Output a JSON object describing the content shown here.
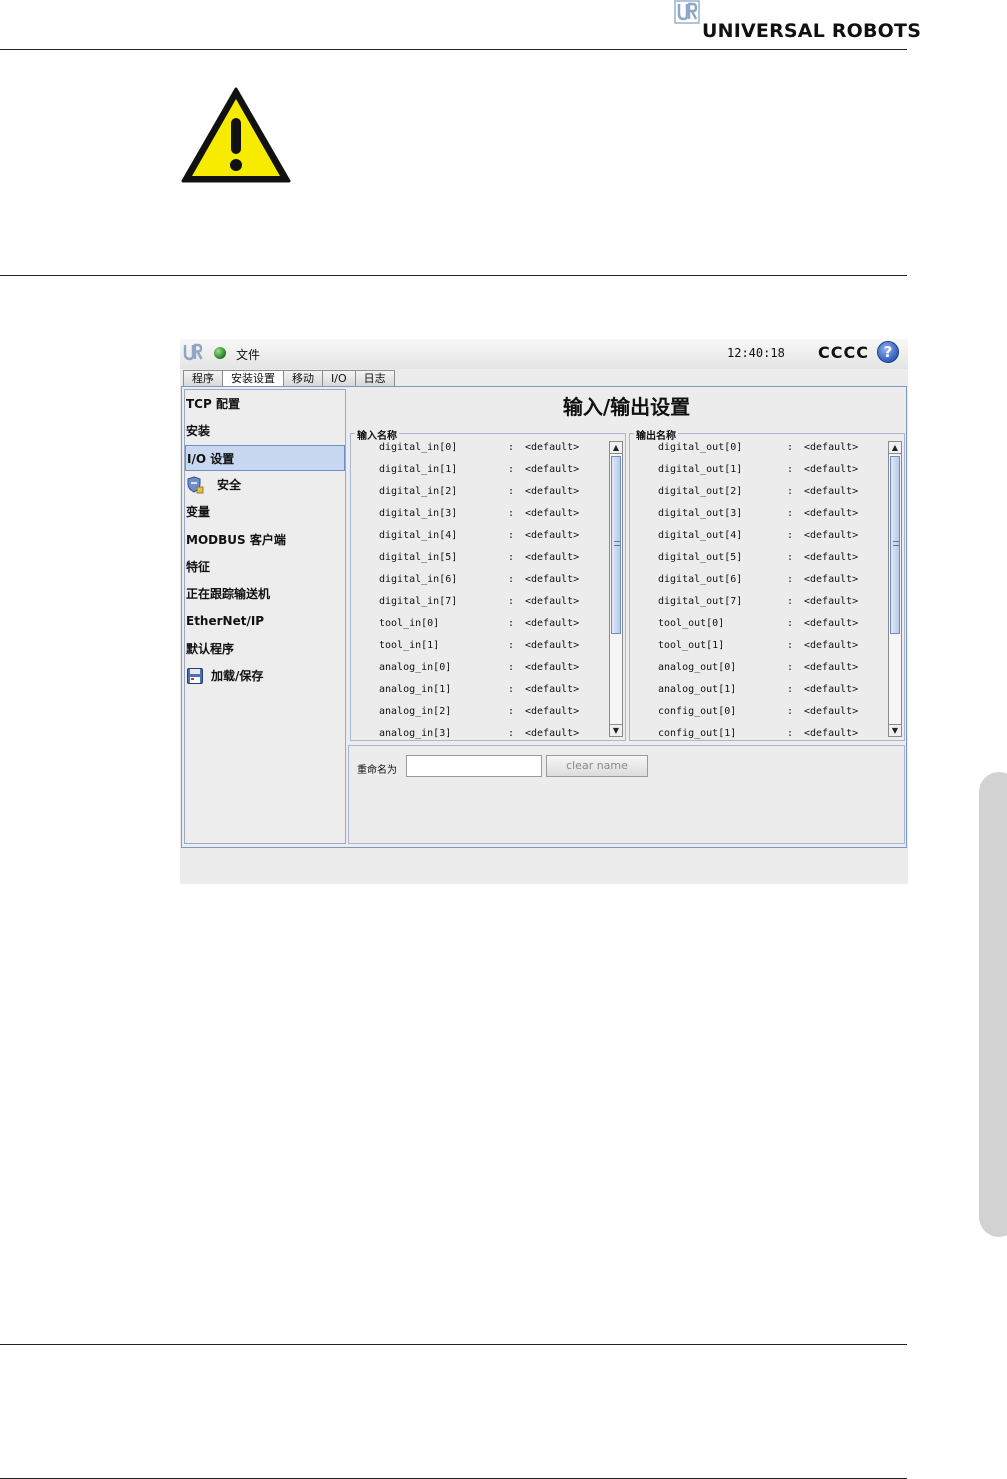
{
  "header": {
    "brand_text": "UNIVERSAL ROBOTS",
    "logo_letters": "UR"
  },
  "warning": {
    "icon": "warning-triangle-icon"
  },
  "app": {
    "titlebar": {
      "file_menu": "文件",
      "clock": "12:40:18",
      "robot_name": "CCCC",
      "help_symbol": "?"
    },
    "tabs": [
      {
        "label": "程序",
        "active": false
      },
      {
        "label": "安装设置",
        "active": true
      },
      {
        "label": "移动",
        "active": false
      },
      {
        "label": "I/O",
        "active": false
      },
      {
        "label": "日志",
        "active": false
      }
    ],
    "menu": {
      "items": [
        {
          "label": "TCP 配置"
        },
        {
          "label": "安装"
        },
        {
          "label": "I/O 设置",
          "selected": true
        },
        {
          "label": "安全",
          "icon": "shield-lock-icon"
        },
        {
          "label": "变量"
        },
        {
          "label": "MODBUS 客户端"
        },
        {
          "label": "特征"
        },
        {
          "label": "正在跟踪输送机"
        },
        {
          "label": "EtherNet/IP"
        },
        {
          "label": "默认程序"
        },
        {
          "label": "加载/保存",
          "icon": "floppy-disk-icon"
        }
      ]
    },
    "content": {
      "title": "输入/输出设置",
      "inputs": {
        "title": "输入名称",
        "rows": [
          {
            "name": "digital_in[0]",
            "sep": ":",
            "value": "<default>"
          },
          {
            "name": "digital_in[1]",
            "sep": ":",
            "value": "<default>"
          },
          {
            "name": "digital_in[2]",
            "sep": ":",
            "value": "<default>"
          },
          {
            "name": "digital_in[3]",
            "sep": ":",
            "value": "<default>"
          },
          {
            "name": "digital_in[4]",
            "sep": ":",
            "value": "<default>"
          },
          {
            "name": "digital_in[5]",
            "sep": ":",
            "value": "<default>"
          },
          {
            "name": "digital_in[6]",
            "sep": ":",
            "value": "<default>"
          },
          {
            "name": "digital_in[7]",
            "sep": ":",
            "value": "<default>"
          },
          {
            "name": "tool_in[0]",
            "sep": ":",
            "value": "<default>"
          },
          {
            "name": "tool_in[1]",
            "sep": ":",
            "value": "<default>"
          },
          {
            "name": "analog_in[0]",
            "sep": ":",
            "value": "<default>"
          },
          {
            "name": "analog_in[1]",
            "sep": ":",
            "value": "<default>"
          },
          {
            "name": "analog_in[2]",
            "sep": ":",
            "value": "<default>"
          },
          {
            "name": "analog_in[3]",
            "sep": ":",
            "value": "<default>"
          }
        ]
      },
      "outputs": {
        "title": "输出名称",
        "rows": [
          {
            "name": "digital_out[0]",
            "sep": ":",
            "value": "<default>"
          },
          {
            "name": "digital_out[1]",
            "sep": ":",
            "value": "<default>"
          },
          {
            "name": "digital_out[2]",
            "sep": ":",
            "value": "<default>"
          },
          {
            "name": "digital_out[3]",
            "sep": ":",
            "value": "<default>"
          },
          {
            "name": "digital_out[4]",
            "sep": ":",
            "value": "<default>"
          },
          {
            "name": "digital_out[5]",
            "sep": ":",
            "value": "<default>"
          },
          {
            "name": "digital_out[6]",
            "sep": ":",
            "value": "<default>"
          },
          {
            "name": "digital_out[7]",
            "sep": ":",
            "value": "<default>"
          },
          {
            "name": "tool_out[0]",
            "sep": ":",
            "value": "<default>"
          },
          {
            "name": "tool_out[1]",
            "sep": ":",
            "value": "<default>"
          },
          {
            "name": "analog_out[0]",
            "sep": ":",
            "value": "<default>"
          },
          {
            "name": "analog_out[1]",
            "sep": ":",
            "value": "<default>"
          },
          {
            "name": "config_out[0]",
            "sep": ":",
            "value": "<default>"
          },
          {
            "name": "config_out[1]",
            "sep": ":",
            "value": "<default>"
          }
        ]
      },
      "rename": {
        "label": "重命名为",
        "input_value": "",
        "clear_button": "clear name"
      }
    }
  },
  "colors": {
    "selection": "#c9d8f1",
    "frame_border": "#7d97c7",
    "warning_yellow": "#f7ec00",
    "status_green": "#2a8a2a",
    "help_blue": "#2a58b8"
  }
}
